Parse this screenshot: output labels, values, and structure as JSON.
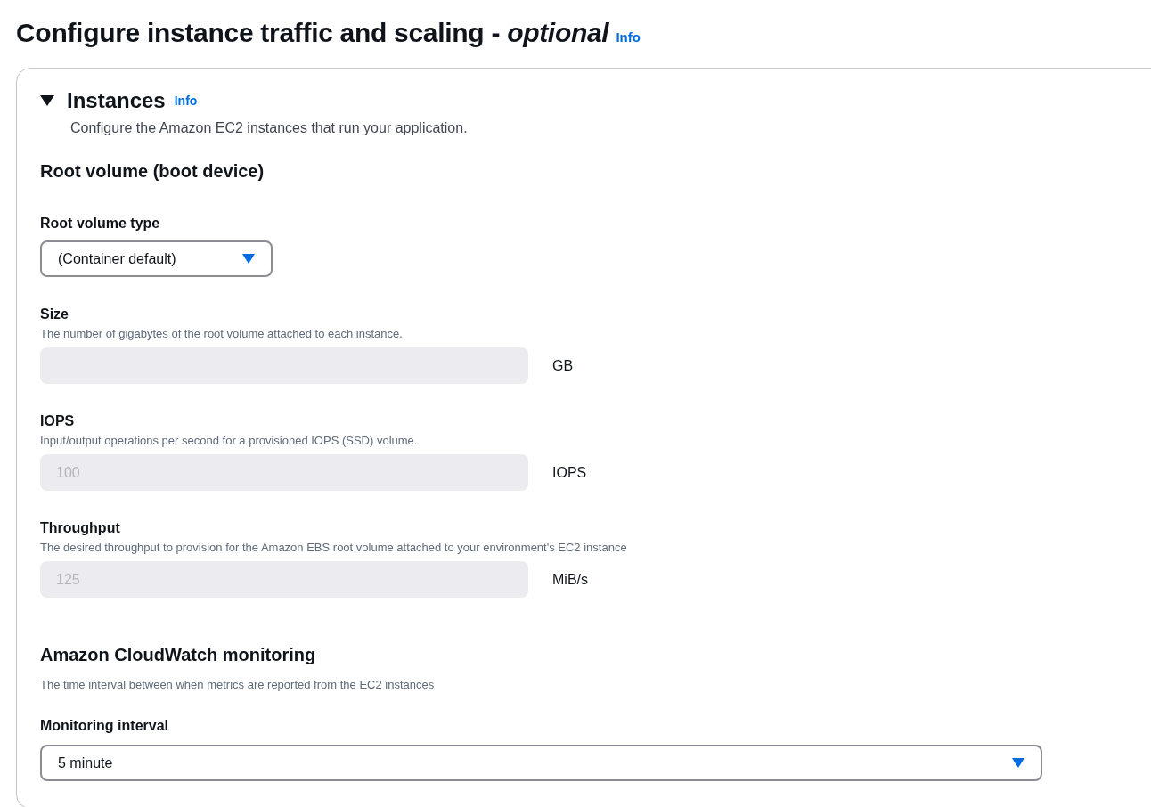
{
  "page_title": "Configure instance traffic and scaling - *optional*",
  "page_info": "Info",
  "section": {
    "title": "Instances",
    "info": "Info",
    "expanded": true,
    "description": "Configure the Amazon EC2 instances that run your application.",
    "groups": [
      {
        "heading": "Root volume (boot device)",
        "fields": [
          {
            "kind": "select",
            "label": "Root volume type",
            "value": "(Container default)"
          },
          {
            "kind": "input",
            "label": "Size",
            "hint": "The number of gigabytes of the root volume attached to each instance.",
            "unit": "GB",
            "disabled": true
          },
          {
            "kind": "input",
            "label": "IOPS",
            "hint": "Input/output operations per second for a provisioned IOPS (SSD) volume.",
            "placeholder": "100",
            "unit": "IOPS",
            "disabled": true
          },
          {
            "kind": "input",
            "label": "Throughput",
            "hint": "The desired throughput to provision for the Amazon EBS root volume attached to your environment's EC2 instance",
            "placeholder": "125",
            "unit": "MiB/s",
            "disabled": true
          }
        ]
      },
      {
        "heading": "Amazon CloudWatch monitoring",
        "description": "The time interval between when metrics are reported from the EC2 instances",
        "fields": [
          {
            "kind": "select",
            "label": "Monitoring interval",
            "value": "5 minute"
          }
        ]
      }
    ]
  }
}
